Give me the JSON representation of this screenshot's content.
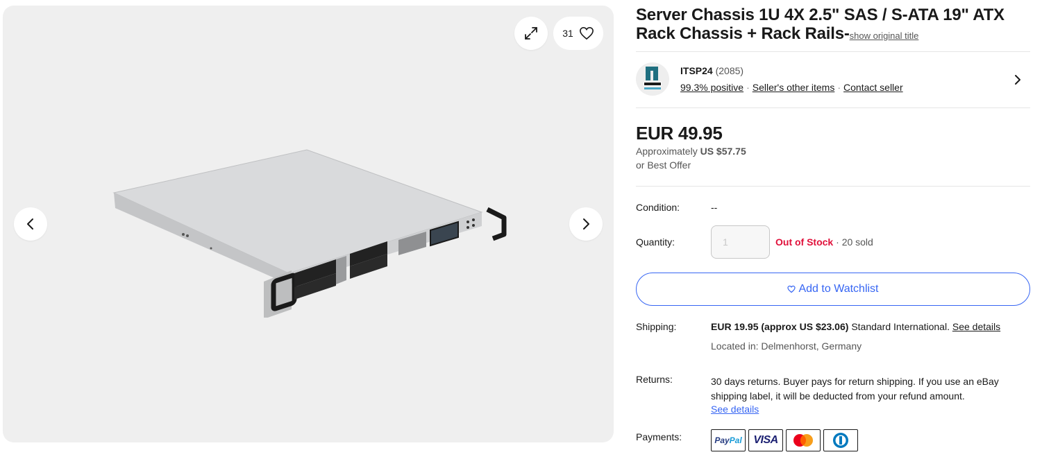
{
  "gallery": {
    "like_count": "31",
    "icons": {
      "expand": "expand-icon",
      "heart": "heart-icon",
      "prev": "chevron-left-icon",
      "next": "chevron-right-icon"
    }
  },
  "listing": {
    "title": "Server Chassis 1U 4X 2.5\" SAS / S-ATA 19\" ATX Rack Chassis + Rack Rails-",
    "show_original_title": "show original title"
  },
  "seller": {
    "name": "ITSP24",
    "feedback_count": "(2085)",
    "positive": "99.3% positive",
    "other_items": "Seller's other items",
    "contact": "Contact seller",
    "logo_text_top": "SERVICE",
    "logo_text_bottom": "PETERSEN"
  },
  "price": {
    "main": "EUR 49.95",
    "approx_label": "Approximately",
    "approx_value": "US $57.75",
    "best_offer": "or Best Offer"
  },
  "condition": {
    "label": "Condition:",
    "value": "--"
  },
  "quantity": {
    "label": "Quantity:",
    "placeholder": "1",
    "stock_status": "Out of Stock",
    "separator": "·",
    "sold": "20 sold"
  },
  "watchlist": {
    "label": "Add to Watchlist",
    "icon": "heart-icon"
  },
  "shipping": {
    "label": "Shipping:",
    "cost": "EUR 19.95 (approx US $23.06)",
    "method": "Standard International.",
    "see_details": "See details",
    "located": "Located in: Delmenhorst, Germany"
  },
  "returns": {
    "label": "Returns:",
    "text": "30 days returns. Buyer pays for return shipping. If you use an eBay shipping label, it will be deducted from your refund amount.",
    "see_details": "See details"
  },
  "payments": {
    "label": "Payments:",
    "methods": [
      "PayPal",
      "VISA",
      "Mastercard",
      "Diners Club"
    ]
  },
  "colors": {
    "accent": "#3665f3",
    "out_of_stock": "#e0103a",
    "muted": "#555555"
  }
}
